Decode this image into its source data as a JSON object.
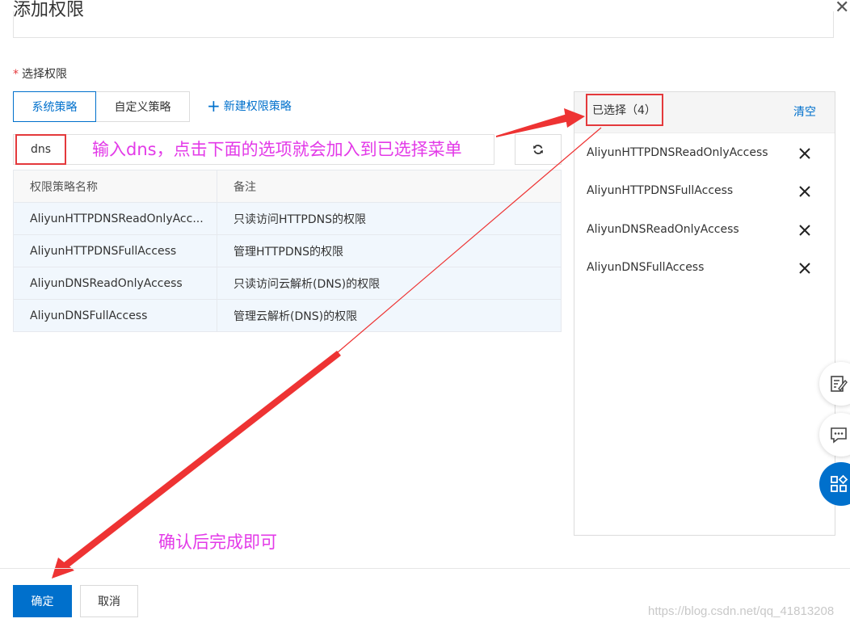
{
  "dialog": {
    "title": "添加权限",
    "section_label": "选择权限",
    "required_mark": "*"
  },
  "tabs": [
    {
      "label": "系统策略",
      "active": true
    },
    {
      "label": "自定义策略",
      "active": false
    }
  ],
  "new_policy_label": "新建权限策略",
  "search": {
    "value": "dns"
  },
  "table": {
    "headers": [
      "权限策略名称",
      "备注"
    ],
    "rows": [
      {
        "name": "AliyunHTTPDNSReadOnlyAcc...",
        "note": "只读访问HTTPDNS的权限"
      },
      {
        "name": "AliyunHTTPDNSFullAccess",
        "note": "管理HTTPDNS的权限"
      },
      {
        "name": "AliyunDNSReadOnlyAccess",
        "note": "只读访问云解析(DNS)的权限"
      },
      {
        "name": "AliyunDNSFullAccess",
        "note": "管理云解析(DNS)的权限"
      }
    ]
  },
  "selected_panel": {
    "title": "已选择（4）",
    "clear_label": "清空",
    "items": [
      "AliyunHTTPDNSReadOnlyAccess",
      "AliyunHTTPDNSFullAccess",
      "AliyunDNSReadOnlyAccess",
      "AliyunDNSFullAccess"
    ]
  },
  "annotations": {
    "instruction_1": "输入dns，点击下面的选项就会加入到已选择菜单",
    "instruction_2": "确认后完成即可"
  },
  "footer": {
    "ok_label": "确定",
    "cancel_label": "取消"
  },
  "watermark": "https://blog.csdn.net/qq_41813208",
  "colors": {
    "accent": "#0070cc",
    "annotation": "#e33ae8",
    "highlight_box": "#e4393c",
    "arrow": "#ee3333"
  },
  "icons": {
    "close": "close-icon",
    "refresh": "refresh-icon",
    "plus": "plus-icon",
    "remove": "remove-icon",
    "edit_doc": "edit-document-icon",
    "chat": "chat-icon",
    "apps": "apps-icon"
  }
}
